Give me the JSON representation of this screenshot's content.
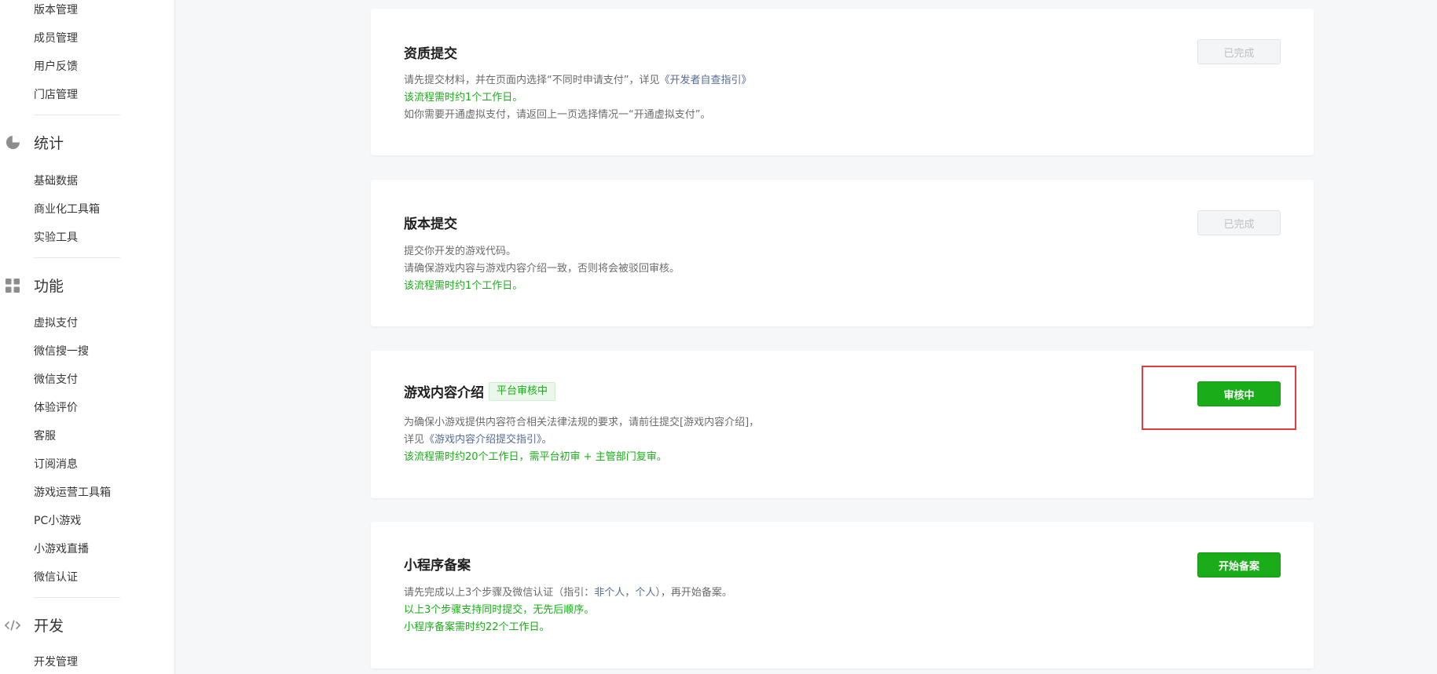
{
  "sidebar": {
    "items_top": [
      "版本管理",
      "成员管理",
      "用户反馈",
      "门店管理"
    ],
    "groups": [
      {
        "label": "统计",
        "icon": "pie-chart-icon",
        "items": [
          "基础数据",
          "商业化工具箱",
          "实验工具"
        ]
      },
      {
        "label": "功能",
        "icon": "grid-icon",
        "items": [
          "虚拟支付",
          "微信搜一搜",
          "微信支付",
          "体验评价",
          "客服",
          "订阅消息",
          "游戏运营工具箱",
          "PC小游戏",
          "小游戏直播",
          "微信认证"
        ]
      },
      {
        "label": "开发",
        "icon": "code-icon",
        "items": [
          "开发管理"
        ]
      }
    ]
  },
  "cards": [
    {
      "title": "资质提交",
      "button": "已完成",
      "lines": [
        {
          "parts": [
            {
              "t": "请先提交材料，并在页面内选择“不同时申请支付”，详见"
            },
            {
              "t": "《开发者自查指引》",
              "c": "link"
            }
          ]
        },
        {
          "parts": [
            {
              "t": "该流程需时约1个工作日。",
              "c": "green"
            }
          ]
        },
        {
          "parts": [
            {
              "t": "如你需要开通虚拟支付，请返回上一页选择情况一“开通虚拟支付”。"
            }
          ]
        }
      ]
    },
    {
      "title": "版本提交",
      "button": "已完成",
      "lines": [
        {
          "parts": [
            {
              "t": "提交你开发的游戏代码。"
            }
          ]
        },
        {
          "parts": [
            {
              "t": "请确保游戏内容与游戏内容介绍一致，否则将会被驳回审核。"
            }
          ]
        },
        {
          "parts": [
            {
              "t": "该流程需时约1个工作日。",
              "c": "green"
            }
          ]
        }
      ]
    },
    {
      "title": "游戏内容介绍",
      "badge": "平台审核中",
      "button": "审核中",
      "lines": [
        {
          "parts": [
            {
              "t": "为确保小游戏提供内容符合相关法律法规的要求，请前往提交[游戏内容介绍]，"
            }
          ]
        },
        {
          "parts": [
            {
              "t": "详见"
            },
            {
              "t": "《游戏内容介绍提交指引》",
              "c": "link"
            },
            {
              "t": "。"
            }
          ]
        },
        {
          "parts": [
            {
              "t": "该流程需时约20个工作日，需平台初审 + 主管部门复审。",
              "c": "green"
            }
          ]
        }
      ]
    },
    {
      "title": "小程序备案",
      "button": "开始备案",
      "lines": [
        {
          "parts": [
            {
              "t": "请先完成以上3个步骤及微信认证（指引："
            },
            {
              "t": "非个人",
              "c": "link"
            },
            {
              "t": "，"
            },
            {
              "t": "个人",
              "c": "link"
            },
            {
              "t": "），再开始备案。"
            }
          ]
        },
        {
          "parts": [
            {
              "t": "以上3个步骤支持同时提交，无先后顺序。",
              "c": "green"
            }
          ]
        },
        {
          "parts": [
            {
              "t": "小程序备案需时约22个工作日。",
              "c": "green"
            }
          ]
        }
      ]
    }
  ],
  "colors": {
    "primary_green": "#1aad19",
    "link_blue": "#576b95",
    "highlight_red": "#e33b3b"
  }
}
